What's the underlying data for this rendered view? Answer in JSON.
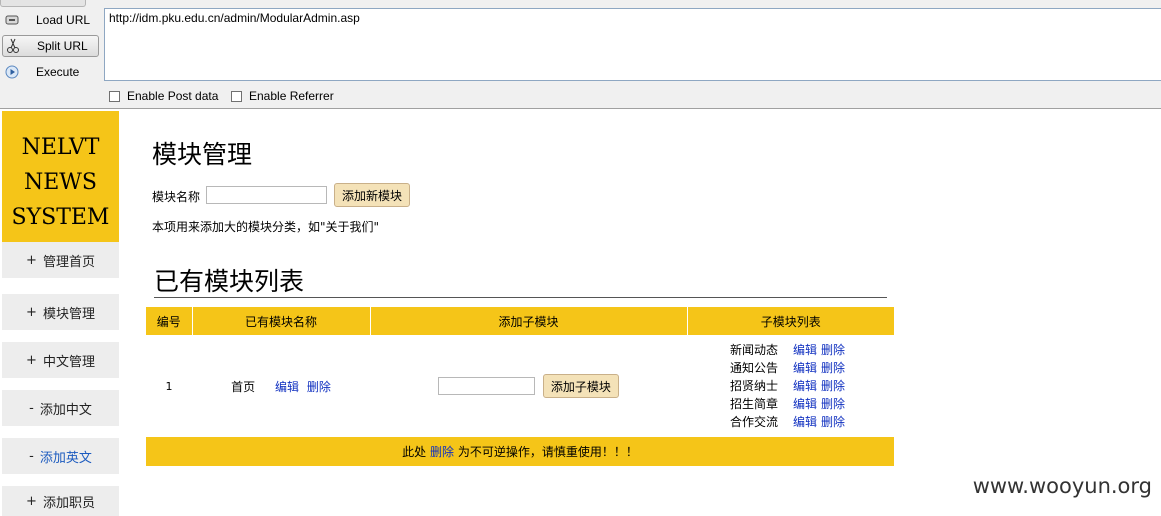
{
  "hackbar": {
    "load_url": "Load URL",
    "split_url": "Split URL",
    "execute": "Execute",
    "url": "http://idm.pku.edu.cn/admin/ModularAdmin.asp",
    "enable_post": "Enable Post data",
    "enable_referrer": "Enable Referrer"
  },
  "logo": {
    "line1": "NELVT",
    "line2": "NEWS",
    "line3": "SYSTEM"
  },
  "nav": [
    {
      "mark": "+",
      "label": "管理首页"
    },
    {
      "mark": "+",
      "label": "模块管理"
    },
    {
      "mark": "+",
      "label": "中文管理"
    },
    {
      "mark": "-",
      "label": "添加中文"
    },
    {
      "mark": "-",
      "label": "添加英文"
    },
    {
      "mark": "+",
      "label": "添加职员"
    }
  ],
  "main": {
    "title": "模块管理",
    "name_label": "模块名称",
    "add_module_button": "添加新模块",
    "hint": "本项用来添加大的模块分类，如\"关于我们\"",
    "list_title": "已有模块列表",
    "columns": [
      "编号",
      "已有模块名称",
      "添加子模块",
      "子模块列表"
    ],
    "row": {
      "id": "1",
      "name": "首页",
      "edit": "编辑",
      "delete": "删除",
      "add_sub_button": "添加子模块"
    },
    "sub_modules": [
      {
        "name": "新闻动态",
        "edit": "编辑",
        "delete": "删除"
      },
      {
        "name": "通知公告",
        "edit": "编辑",
        "delete": "删除"
      },
      {
        "name": "招贤纳士",
        "edit": "编辑",
        "delete": "删除"
      },
      {
        "name": "招生简章",
        "edit": "编辑",
        "delete": "删除"
      },
      {
        "name": "合作交流",
        "edit": "编辑",
        "delete": "删除"
      }
    ],
    "warning_prefix": "此处",
    "warning_link": "删除",
    "warning_suffix": "为不可逆操作，请慎重使用！！！"
  },
  "watermark": "www.wooyun.org",
  "colors": {
    "accent_yellow": "#f5c518",
    "link_blue": "#1030c0",
    "nav_bg": "#ededed"
  }
}
